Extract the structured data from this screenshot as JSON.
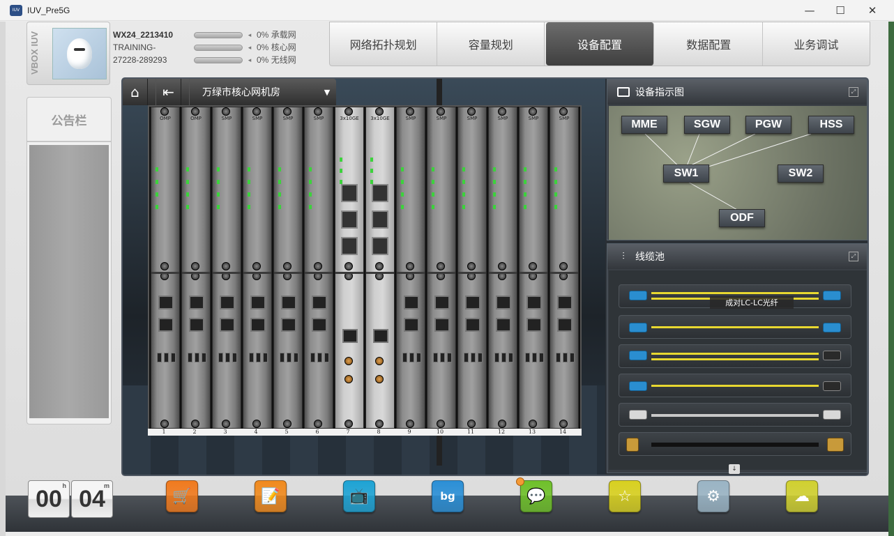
{
  "window": {
    "title": "IUV_Pre5G",
    "icon_text": "IUV",
    "controls": [
      "—",
      "☐",
      "✕"
    ]
  },
  "user": {
    "vbox_label": "VBOX IUV",
    "name": "WX24_2213410",
    "line2": "TRAINING-",
    "line3": "27228-289293",
    "progress": [
      {
        "percent": "0%",
        "label": "承载网",
        "value": 0
      },
      {
        "percent": "0%",
        "label": "核心网",
        "value": 0
      },
      {
        "percent": "0%",
        "label": "无线网",
        "value": 0
      }
    ]
  },
  "tabs": [
    {
      "label": "网络拓扑规划",
      "active": false
    },
    {
      "label": "容量规划",
      "active": false
    },
    {
      "label": "设备配置",
      "active": true
    },
    {
      "label": "数据配置",
      "active": false
    },
    {
      "label": "业务调试",
      "active": false
    }
  ],
  "notice": {
    "title": "公告栏"
  },
  "breadcrumb": {
    "location": "万绿市核心网机房",
    "dropdown_icon": "▼",
    "home_icon": "home-icon",
    "back_icon": "back-icon"
  },
  "chassis": {
    "slots": [
      {
        "num": "1",
        "label": "OMP"
      },
      {
        "num": "2",
        "label": "OMP"
      },
      {
        "num": "3",
        "label": "SMP"
      },
      {
        "num": "4",
        "label": "SMP"
      },
      {
        "num": "5",
        "label": "SMP"
      },
      {
        "num": "6",
        "label": "SMP"
      },
      {
        "num": "7",
        "label": "3x10GE"
      },
      {
        "num": "8",
        "label": "3x10GE"
      },
      {
        "num": "9",
        "label": "SMP"
      },
      {
        "num": "10",
        "label": "SMP"
      },
      {
        "num": "11",
        "label": "SMP"
      },
      {
        "num": "12",
        "label": "SMP"
      },
      {
        "num": "13",
        "label": "SMP"
      },
      {
        "num": "14",
        "label": "SMP"
      }
    ]
  },
  "device_diagram": {
    "title": "设备指示图",
    "nodes": [
      {
        "label": "MME"
      },
      {
        "label": "SGW"
      },
      {
        "label": "PGW"
      },
      {
        "label": "HSS"
      },
      {
        "label": "SW1"
      },
      {
        "label": "SW2"
      },
      {
        "label": "ODF"
      }
    ]
  },
  "cable_pool": {
    "title": "线缆池",
    "tooltip": "成对LC-LC光纤",
    "scroll_icon": "↓",
    "cables": [
      {
        "type": "lc-lc-pair"
      },
      {
        "type": "lc-lc"
      },
      {
        "type": "lc-fc-pair"
      },
      {
        "type": "lc-fc"
      },
      {
        "type": "ethernet"
      },
      {
        "type": "coax"
      }
    ]
  },
  "timer": {
    "hours": "00",
    "hours_unit": "h",
    "minutes": "04",
    "minutes_unit": "m"
  },
  "dock": {
    "icons": [
      {
        "name": "shopping-cart-icon",
        "glyph": "🛒",
        "color": "#f07a1e"
      },
      {
        "name": "notebook-icon",
        "glyph": "📝",
        "color": "#f08a1e"
      },
      {
        "name": "tv-icon",
        "glyph": "📺",
        "color": "#1ea3d4"
      },
      {
        "name": "background-icon",
        "glyph": "bg",
        "color": "#2b8fd6"
      },
      {
        "name": "chat-icon",
        "glyph": "💬",
        "color": "#6fc02a"
      },
      {
        "name": "star-icon",
        "glyph": "☆",
        "color": "#d8d020"
      },
      {
        "name": "gear-icon",
        "glyph": "⚙",
        "color": "#9ab4c4"
      },
      {
        "name": "cloud-icon",
        "glyph": "☁",
        "color": "#d0d030"
      }
    ]
  }
}
